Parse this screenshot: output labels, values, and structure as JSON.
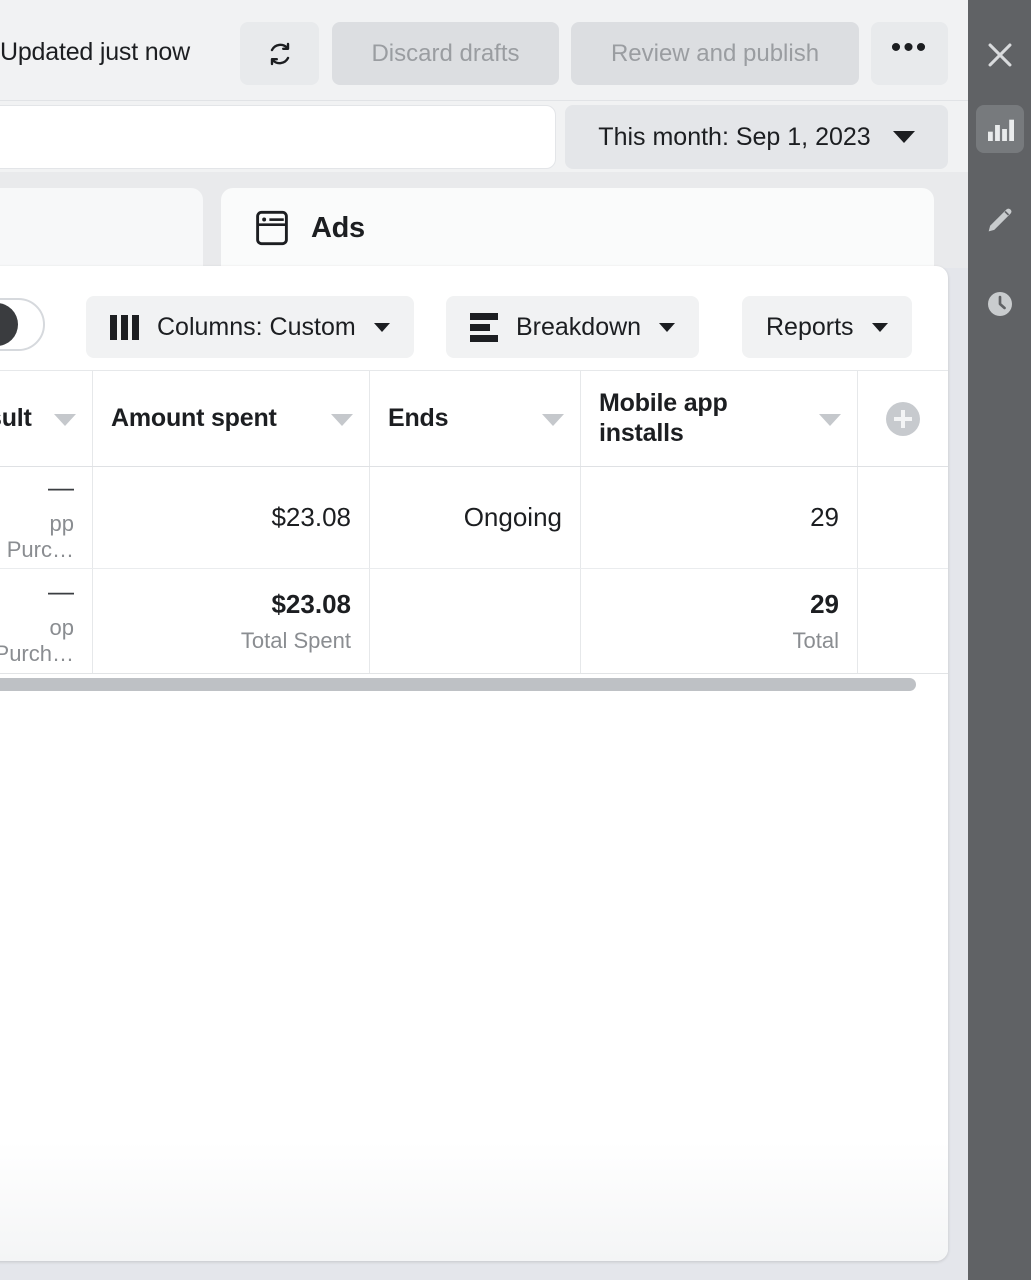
{
  "topbar": {
    "updated_status": "Updated just now",
    "refresh_icon": "refresh-icon",
    "discard_label": "Discard drafts",
    "review_label": "Review and publish",
    "more_label": "•••"
  },
  "searchbar": {
    "search_value": "",
    "search_placeholder": "",
    "date_range_label": "This month: Sep 1, 2023"
  },
  "tabs": {
    "partial_label": "",
    "ads_label": "Ads",
    "ads_icon": "ads-window-icon"
  },
  "controls": {
    "toggle_state": "off",
    "columns_label": "Columns: Custom",
    "columns_icon": "columns-icon",
    "breakdown_label": "Breakdown",
    "breakdown_icon": "breakdown-icon",
    "reports_label": "Reports"
  },
  "table": {
    "headers": [
      {
        "label": "sult",
        "sort_icon": "sort-caret-icon"
      },
      {
        "label": "Amount spent",
        "sort_icon": "sort-caret-icon"
      },
      {
        "label": "Ends",
        "sort_icon": "sort-caret-icon"
      },
      {
        "label": "Mobile app installs",
        "sort_icon": "sort-caret-icon"
      },
      {
        "label": "",
        "sort_icon": "add-column-icon"
      }
    ],
    "rows": [
      {
        "cost_per_result": "—",
        "cost_per_result_sub": "pp Purc…",
        "amount_spent": "$23.08",
        "amount_spent_sub": "",
        "ends": "Ongoing",
        "mobile_app_installs": "29",
        "mobile_app_installs_sub": ""
      }
    ],
    "total_row": {
      "cost_per_result": "—",
      "cost_per_result_sub": "op Purch…",
      "amount_spent": "$23.08",
      "amount_spent_sub": "Total Spent",
      "ends": "",
      "mobile_app_installs": "29",
      "mobile_app_installs_sub": "Total"
    }
  },
  "rail": {
    "close_icon": "close-icon",
    "chart_icon": "bar-chart-icon",
    "pencil_icon": "pencil-edit-icon",
    "clock_icon": "clock-history-icon",
    "active_item": "bar-chart-icon"
  },
  "colors": {
    "rail_bg": "#606265",
    "rail_active_bg": "#777a7d",
    "page_bg": "#e4e6eb",
    "panel_bg": "#ffffff",
    "button_bg": "#dcdee1",
    "text_primary": "#1c1e21",
    "text_muted": "#8a8d91",
    "scrollbar": "#bec1c5"
  }
}
